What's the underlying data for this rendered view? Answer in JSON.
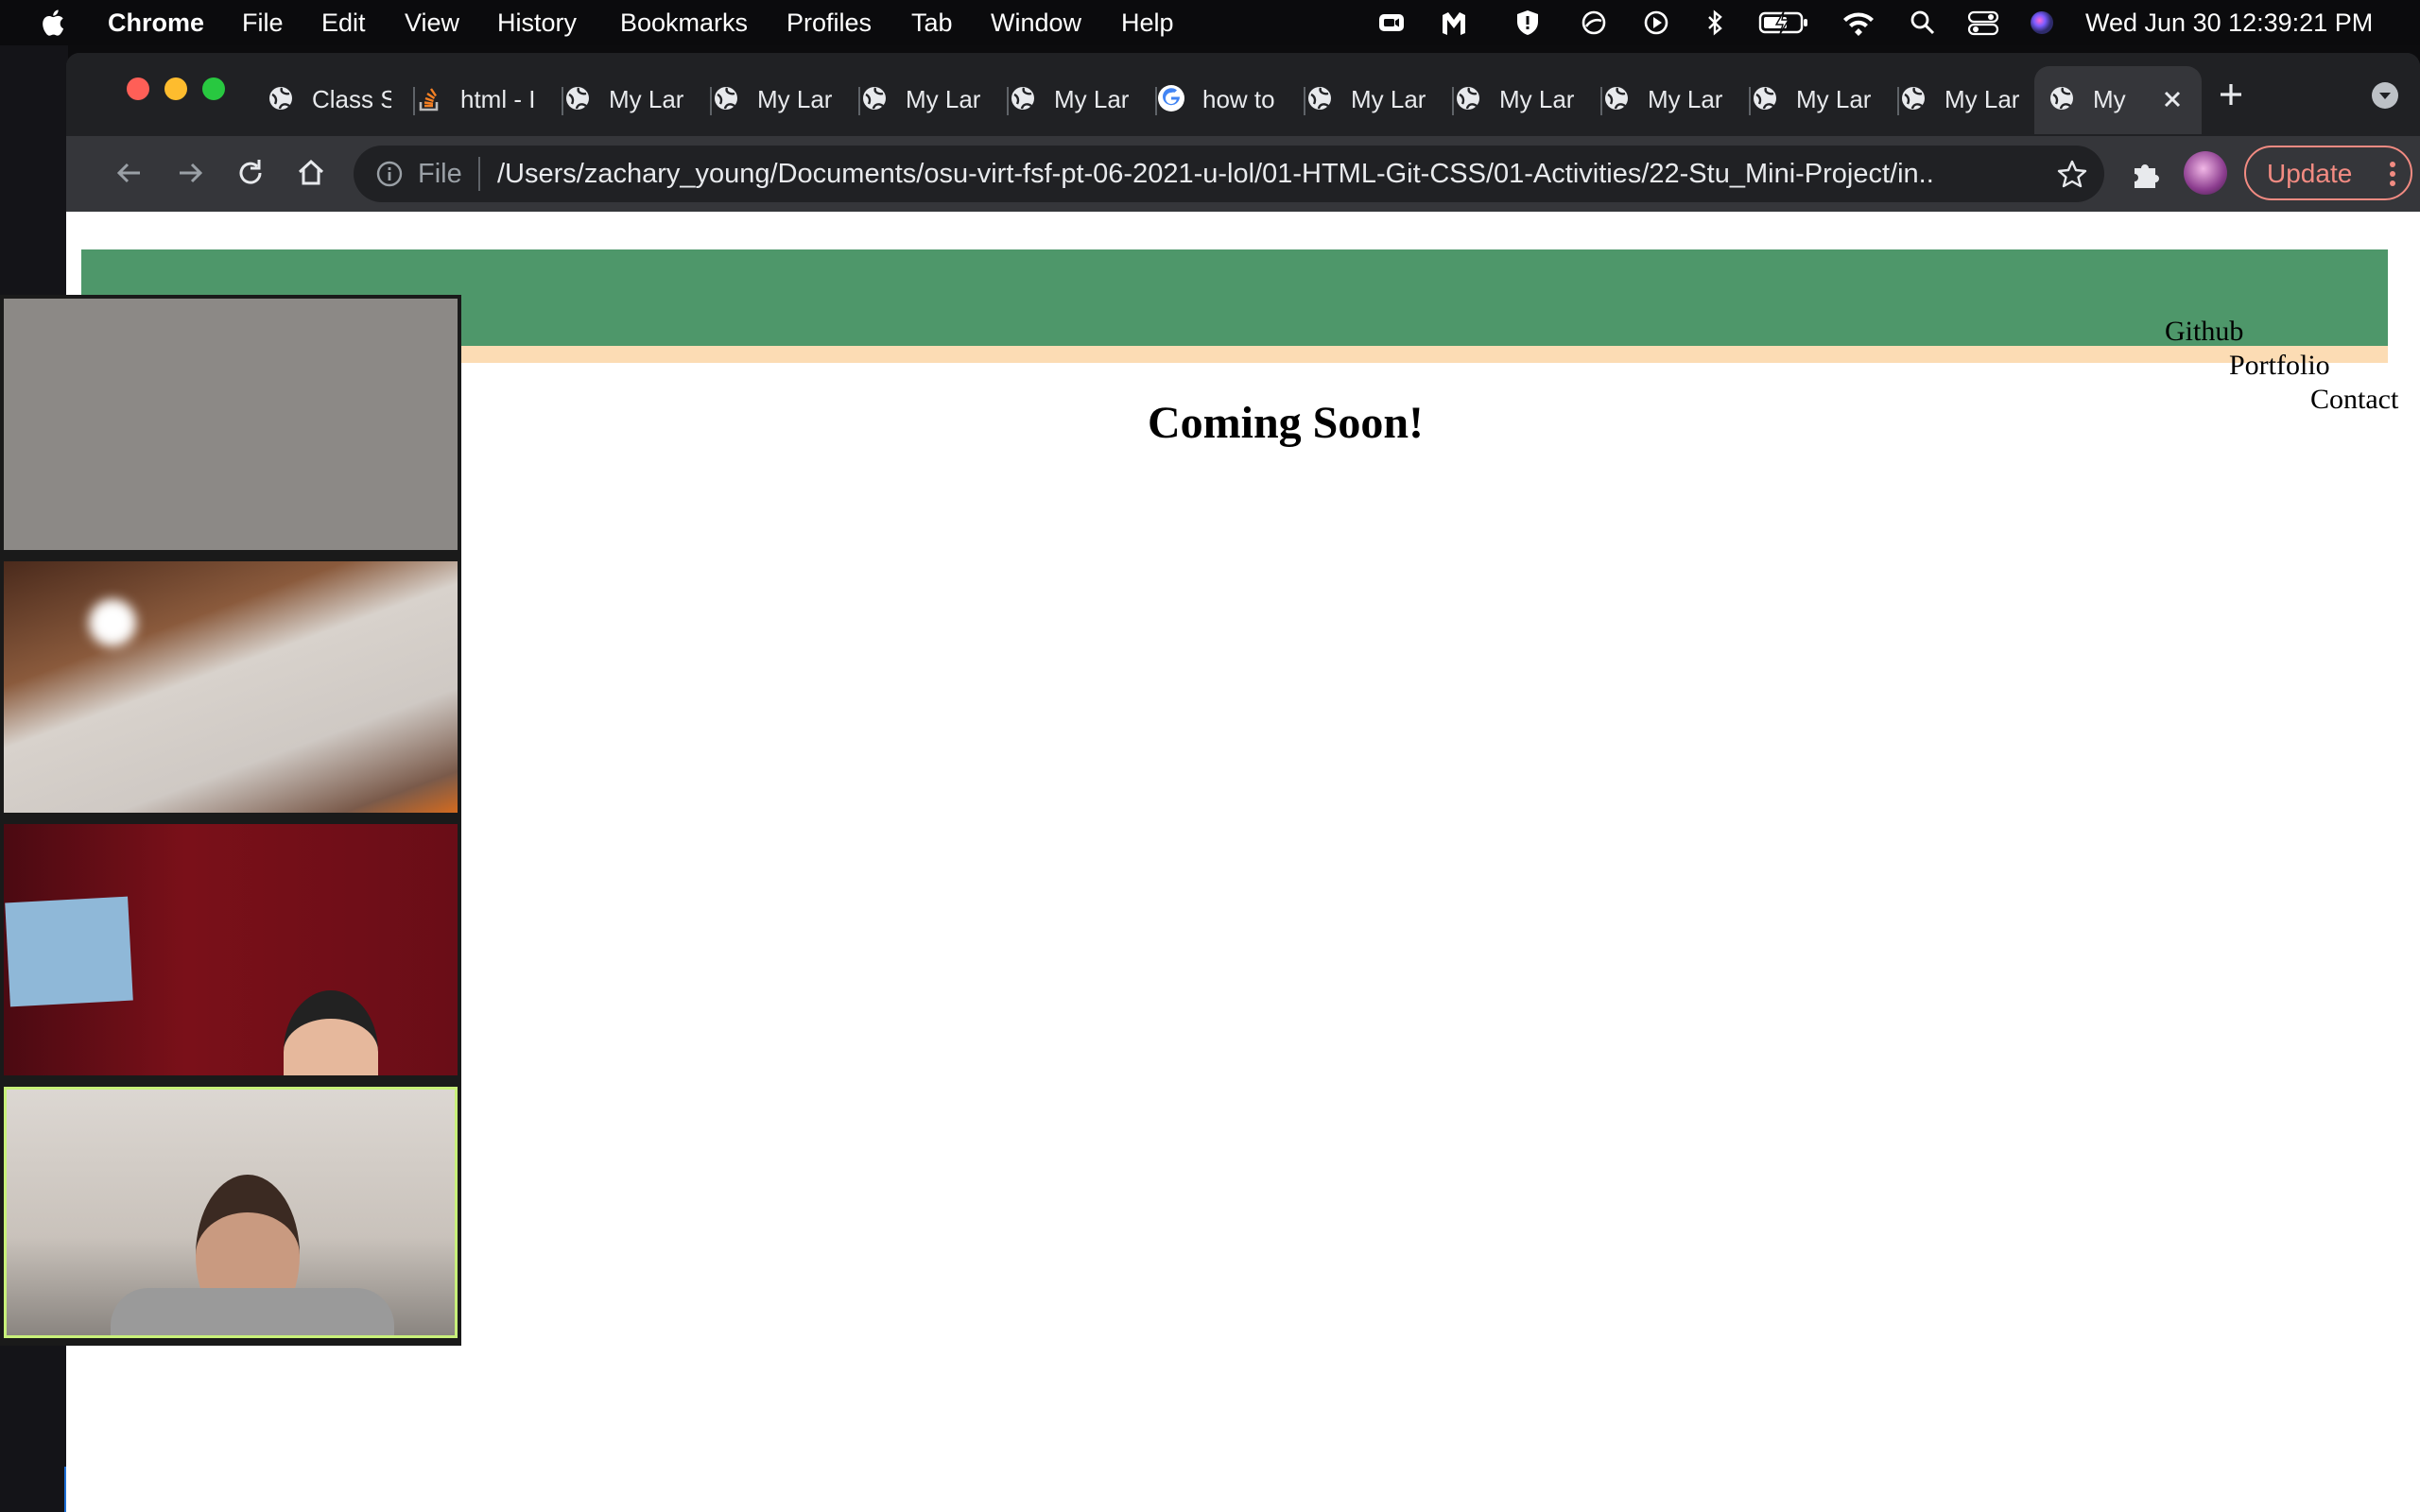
{
  "menubar": {
    "app_name": "Chrome",
    "menus": [
      "File",
      "Edit",
      "View",
      "History",
      "Bookmarks",
      "Profiles",
      "Tab",
      "Window",
      "Help"
    ],
    "clock": "Wed Jun 30  12:39:21 PM"
  },
  "tabs": [
    {
      "title": "Class S",
      "icon": "globe-icon"
    },
    {
      "title": "html - I",
      "icon": "stackoverflow-icon"
    },
    {
      "title": "My Lar",
      "icon": "globe-icon"
    },
    {
      "title": "My Lar",
      "icon": "globe-icon"
    },
    {
      "title": "My Lar",
      "icon": "globe-icon"
    },
    {
      "title": "My Lar",
      "icon": "globe-icon"
    },
    {
      "title": "how to",
      "icon": "google-icon"
    },
    {
      "title": "My Lar",
      "icon": "globe-icon"
    },
    {
      "title": "My Lar",
      "icon": "globe-icon"
    },
    {
      "title": "My Lar",
      "icon": "globe-icon"
    },
    {
      "title": "My Lar",
      "icon": "globe-icon"
    },
    {
      "title": "My Lar",
      "icon": "globe-icon"
    },
    {
      "title": "My",
      "icon": "globe-icon",
      "active": true
    }
  ],
  "omnibox": {
    "scheme": "File",
    "url": "/Users/zachary_young/Documents/osu-virt-fsf-pt-06-2021-u-lol/01-HTML-Git-CSS/01-Activities/22-Stu_Mini-Project/in..."
  },
  "toolbar": {
    "update_label": "Update"
  },
  "page": {
    "nav": [
      "Github",
      "Portfolio",
      "Contact"
    ],
    "heading": "Coming Soon!",
    "colors": {
      "header": "#4e976a",
      "band": "#fcdcb4"
    }
  },
  "zoom": {
    "tiles": [
      "participant-video-1",
      "participant-video-2",
      "participant-video-3",
      "participant-video-4"
    ],
    "active_tile": 4
  }
}
